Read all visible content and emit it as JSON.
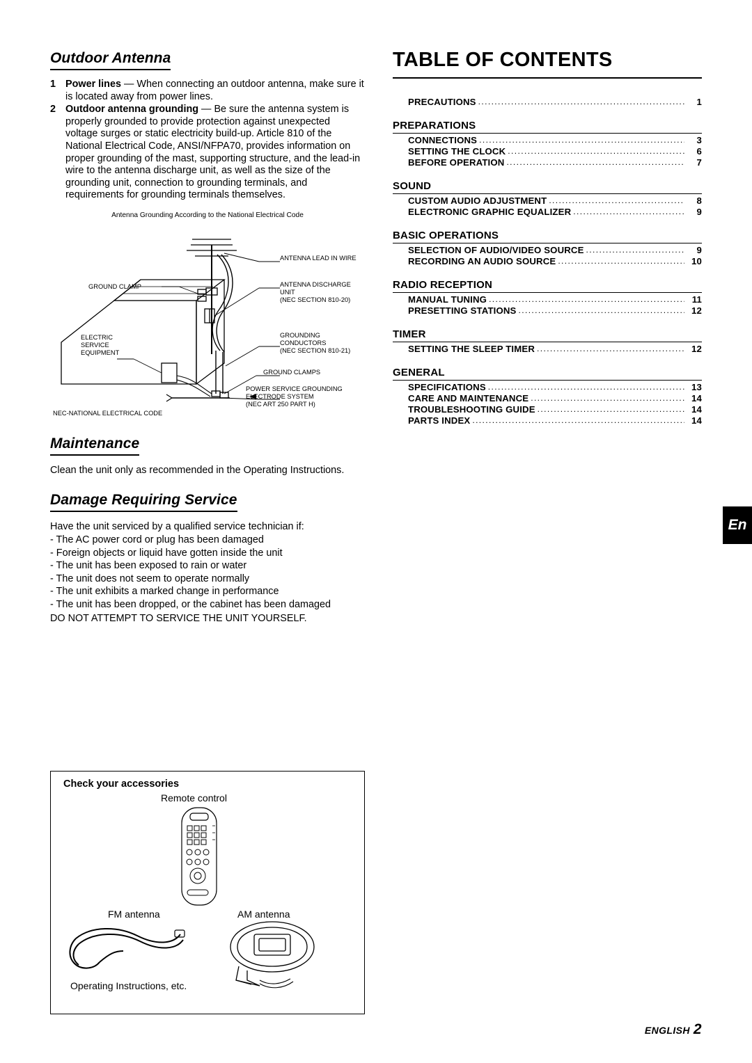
{
  "left": {
    "outdoor_antenna": {
      "heading": "Outdoor Antenna",
      "items": [
        {
          "num": "1",
          "bold": "Power lines",
          "text": " — When connecting an outdoor antenna, make sure it is located away from power lines."
        },
        {
          "num": "2",
          "bold": "Outdoor antenna grounding",
          "text": " — Be sure the antenna system is properly grounded to provide protection against unexpected voltage surges or static electricity build-up.  Article 810 of the National Electrical Code, ANSI/NFPA70, provides information on proper grounding of the mast, supporting structure, and the lead-in wire to the antenna discharge unit, as well as the size of the grounding unit, connection to grounding terminals, and requirements for grounding terminals themselves."
        }
      ]
    },
    "diagram": {
      "caption": "Antenna Grounding According to the National Electrical Code",
      "labels": {
        "antenna_lead_in_wire": "ANTENNA LEAD IN WIRE",
        "antenna_discharge_unit": "ANTENNA DISCHARGE",
        "antenna_discharge_unit2": "UNIT",
        "nec_810_20": "(NEC SECTION 810-20)",
        "ground_clamp": "GROUND CLAMP",
        "electric": "ELECTRIC",
        "service": "SERVICE",
        "equipment": "EQUIPMENT",
        "grounding": "GROUNDING",
        "conductors": "CONDUCTORS",
        "nec_810_21": "(NEC SECTION 810-21)",
        "ground_clamps": "GROUND CLAMPS",
        "power_service_grounding": "POWER SERVICE GROUNDING",
        "electrode_system": "ELECTRODE SYSTEM",
        "nec_art_250": "(NEC ART 250 PART H)",
        "nec_national": "NEC-NATIONAL ELECTRICAL CODE"
      }
    },
    "maintenance": {
      "heading": "Maintenance",
      "text": "Clean the unit only as recommended in the Operating Instructions."
    },
    "damage": {
      "heading": "Damage Requiring Service",
      "intro": "Have the unit serviced by a qualified service technician if:",
      "items": [
        "- The AC power cord or plug has been damaged",
        "- Foreign objects or liquid have gotten inside the unit",
        "- The unit has been exposed to rain or water",
        "- The unit does not seem to operate normally",
        "- The unit exhibits a marked change in performance",
        "- The unit has been dropped, or the cabinet has been damaged"
      ],
      "warning": "DO NOT ATTEMPT TO SERVICE THE UNIT YOURSELF."
    },
    "accessories": {
      "title": "Check your accessories",
      "remote": "Remote control",
      "fm": "FM antenna",
      "am": "AM antenna",
      "instructions": "Operating Instructions, etc."
    }
  },
  "right": {
    "title": "TABLE OF CONTENTS",
    "top_entries": [
      {
        "label": "PRECAUTIONS",
        "page": "1"
      }
    ],
    "groups": [
      {
        "name": "PREPARATIONS",
        "entries": [
          {
            "label": "CONNECTIONS",
            "page": "3"
          },
          {
            "label": "SETTING THE CLOCK",
            "page": "6"
          },
          {
            "label": "BEFORE OPERATION",
            "page": "7"
          }
        ]
      },
      {
        "name": "SOUND",
        "entries": [
          {
            "label": "CUSTOM AUDIO ADJUSTMENT",
            "page": "8"
          },
          {
            "label": "ELECTRONIC GRAPHIC EQUALIZER",
            "page": "9"
          }
        ]
      },
      {
        "name": "BASIC OPERATIONS",
        "entries": [
          {
            "label": "SELECTION OF AUDIO/VIDEO SOURCE",
            "page": "9"
          },
          {
            "label": "RECORDING AN AUDIO SOURCE",
            "page": "10"
          }
        ]
      },
      {
        "name": "RADIO RECEPTION",
        "entries": [
          {
            "label": "MANUAL TUNING",
            "page": "11"
          },
          {
            "label": "PRESETTING STATIONS",
            "page": "12"
          }
        ]
      },
      {
        "name": "TIMER",
        "entries": [
          {
            "label": "SETTING THE SLEEP TIMER",
            "page": "12"
          }
        ]
      },
      {
        "name": "GENERAL",
        "entries": [
          {
            "label": "SPECIFICATIONS",
            "page": "13"
          },
          {
            "label": "CARE AND MAINTENANCE",
            "page": "14"
          },
          {
            "label": "TROUBLESHOOTING GUIDE",
            "page": "14"
          },
          {
            "label": "PARTS INDEX",
            "page": "14"
          }
        ]
      }
    ]
  },
  "tab": {
    "label": "En"
  },
  "footer": {
    "language": "ENGLISH",
    "page": "2"
  }
}
